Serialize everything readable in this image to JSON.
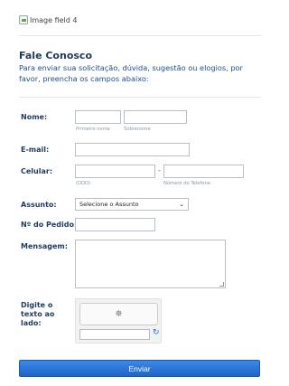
{
  "header": {
    "image_alt": "Image field 4"
  },
  "intro": {
    "title": "Fale Conosco",
    "text": "Para enviar sua solicitação, dúvida, sugestão ou elogios, por favor, preencha os campos abaixo:"
  },
  "form": {
    "nome": {
      "label": "Nome:",
      "first_hint": "Primeiro nome",
      "last_hint": "Sobrenome",
      "first_value": "",
      "last_value": ""
    },
    "email": {
      "label": "E-mail:",
      "value": ""
    },
    "celular": {
      "label": "Celular:",
      "ddd_hint": "(DDD)",
      "separator": "-",
      "number_hint": "Número do Telefone",
      "ddd_value": "",
      "number_value": ""
    },
    "assunto": {
      "label": "Assunto:",
      "selected": "Selecione o Assunto"
    },
    "pedido": {
      "label": "Nº do Pedido:",
      "value": ""
    },
    "mensagem": {
      "label": "Mensagem:",
      "value": ""
    },
    "captcha": {
      "label": "Digite o texto ao lado:",
      "spinner_icon": "loading-spinner-icon",
      "refresh_icon": "refresh-icon",
      "value": ""
    },
    "submit_label": "Enviar"
  },
  "colors": {
    "heading": "#1f3a5c",
    "intro_text": "#1f4e8c",
    "button": "#2a78d8"
  }
}
